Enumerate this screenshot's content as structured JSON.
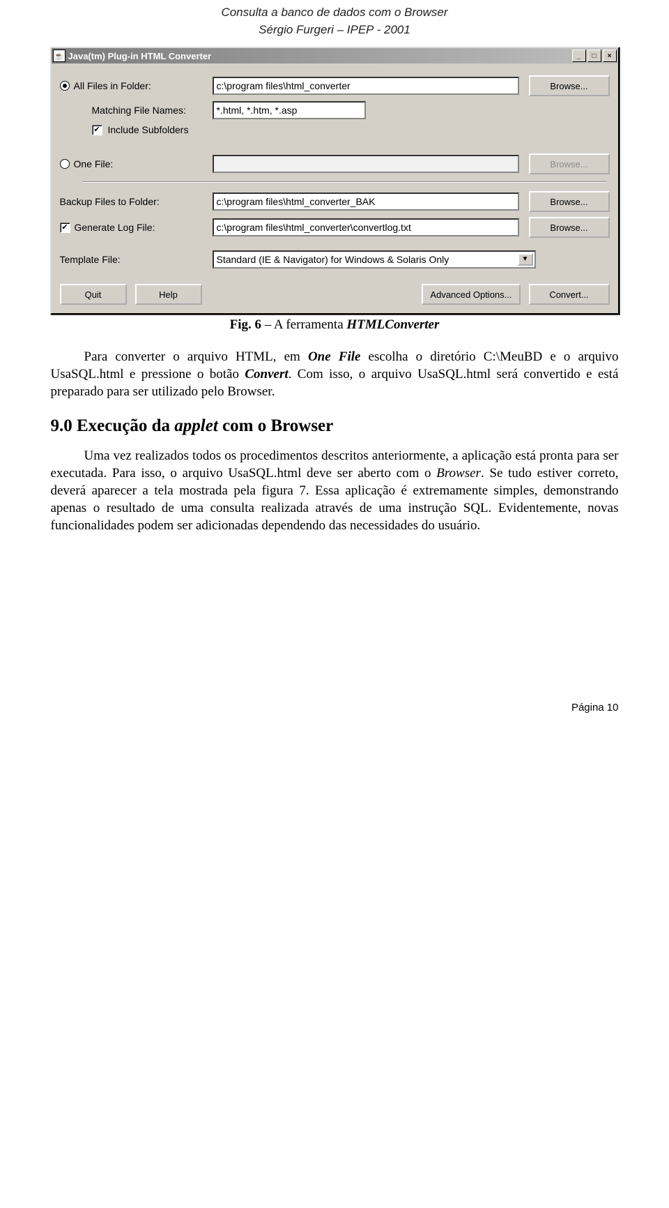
{
  "header": {
    "line1": "Consulta a banco de dados com o Browser",
    "line2": "Sérgio Furgeri – IPEP - 2001"
  },
  "window": {
    "title": "Java(tm) Plug-in HTML Converter",
    "radio_all_label": "All Files in Folder:",
    "all_path": "c:\\program files\\html_converter",
    "browse": "Browse...",
    "matching_label": "Matching File Names:",
    "matching_value": "*.html, *.htm, *.asp",
    "include_subfolders": "Include Subfolders",
    "radio_one_label": "One File:",
    "one_path": "",
    "backup_label": "Backup Files to Folder:",
    "backup_value": "c:\\program files\\html_converter_BAK",
    "genlog_label": "Generate Log File:",
    "genlog_value": "c:\\program files\\html_converter\\convertlog.txt",
    "template_label": "Template File:",
    "template_value": "Standard (IE & Navigator) for Windows & Solaris Only",
    "quit": "Quit",
    "help": "Help",
    "advanced": "Advanced Options...",
    "convert": "Convert..."
  },
  "figcap_label": "Fig. 6",
  "figcap_text": " – A ferramenta ",
  "figcap_name": "HTMLConverter",
  "para1_a": "Para converter o arquivo HTML, em ",
  "para1_onefile": "One File",
  "para1_b": "  escolha o diretório C:\\MeuBD e o arquivo UsaSQL.html e pressione o botão ",
  "para1_convert": "Convert",
  "para1_c": ". Com isso, o arquivo UsaSQL.html será convertido e está preparado para ser utilizado pelo Browser.",
  "section_num": "9.0 Execução da ",
  "section_applet": "applet",
  "section_rest": " com o Browser",
  "para2_a": "Uma vez realizados todos os procedimentos descritos anteriormente, a aplicação está pronta para ser executada. Para isso, o arquivo UsaSQL.html deve ser aberto com o ",
  "para2_browser": "Browser",
  "para2_b": ". Se tudo estiver correto, deverá aparecer a tela mostrada pela figura 7. Essa aplicação é extremamente simples, demonstrando apenas o resultado de uma consulta realizada através de uma instrução SQL. Evidentemente, novas funcionalidades podem ser adicionadas dependendo das necessidades do usuário.",
  "pagenum": "Página 10"
}
